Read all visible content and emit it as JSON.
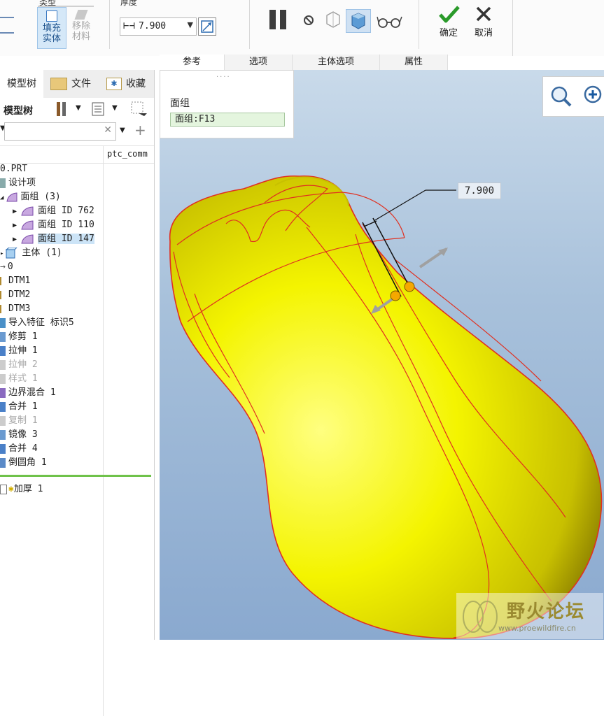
{
  "ribbon": {
    "group_type": "类型",
    "group_thickness": "厚度",
    "fill_solid": "填充\n实体",
    "remove_material": "移除\n材料",
    "thickness_value": "7.900",
    "confirm": "确定",
    "cancel": "取消"
  },
  "tabs": [
    "参考",
    "选项",
    "主体选项",
    "属性"
  ],
  "ref_panel": {
    "label": "面组",
    "value": "面组:F13"
  },
  "left_tabs": [
    "模型树",
    "文件",
    "收藏"
  ],
  "model_tree": {
    "title": "模型树",
    "column_header": "ptc_comm",
    "items": [
      {
        "text": "0.PRT",
        "dim": false
      },
      {
        "text": "设计项",
        "dim": false
      },
      {
        "text": "面组 (3)",
        "dim": false
      },
      {
        "text": "面组 ID 762",
        "dim": false
      },
      {
        "text": "面组 ID 110",
        "dim": false
      },
      {
        "text": "面组 ID 147",
        "dim": false
      },
      {
        "text": "主体 (1)",
        "dim": false
      },
      {
        "text": "0",
        "dim": false
      },
      {
        "text": "DTM1",
        "dim": false
      },
      {
        "text": "DTM2",
        "dim": false
      },
      {
        "text": "DTM3",
        "dim": false
      },
      {
        "text": "导入特征 标识5",
        "dim": false
      },
      {
        "text": "修剪 1",
        "dim": false
      },
      {
        "text": "拉伸 1",
        "dim": false
      },
      {
        "text": "拉伸 2",
        "dim": true
      },
      {
        "text": "样式 1",
        "dim": true
      },
      {
        "text": "边界混合 1",
        "dim": false
      },
      {
        "text": "合并 1",
        "dim": false
      },
      {
        "text": "复制 1",
        "dim": true
      },
      {
        "text": "镜像 3",
        "dim": false
      },
      {
        "text": "合并 4",
        "dim": false
      },
      {
        "text": "倒圆角 1",
        "dim": false
      },
      {
        "text": "加厚 1",
        "dim": false
      }
    ]
  },
  "dimension_label": "7.900",
  "watermark": {
    "title": "野火论坛",
    "url": "www.proewildfire.cn"
  },
  "colors": {
    "part_yellow": "#f2f200",
    "edge_red": "#e03020",
    "confirm_green": "#2a9a2a",
    "selected_row": "#cce4f7"
  }
}
